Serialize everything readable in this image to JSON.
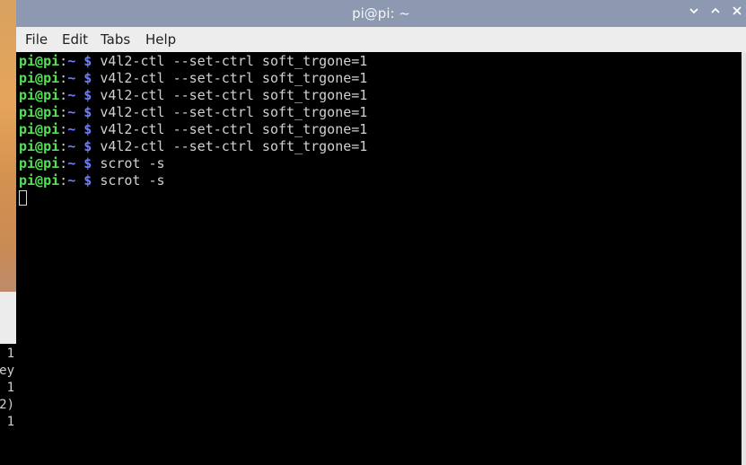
{
  "window": {
    "title": "pi@pi: ~",
    "controls": {
      "minimize": "⌄",
      "maximize": "⌃",
      "close": "✕"
    }
  },
  "menubar": {
    "items": [
      {
        "label": "File"
      },
      {
        "label": "Edit"
      },
      {
        "label": "Tabs"
      },
      {
        "label": "Help"
      }
    ]
  },
  "terminal": {
    "prompt": {
      "user": "pi@pi",
      "colon": ":",
      "path": "~",
      "dollar": "$"
    },
    "lines": [
      {
        "command": "v4l2-ctl --set-ctrl soft_trgone=1"
      },
      {
        "command": "v4l2-ctl --set-ctrl soft_trgone=1"
      },
      {
        "command": "v4l2-ctl --set-ctrl soft_trgone=1"
      },
      {
        "command": "v4l2-ctl --set-ctrl soft_trgone=1"
      },
      {
        "command": "v4l2-ctl --set-ctrl soft_trgone=1"
      },
      {
        "command": "v4l2-ctl --set-ctrl soft_trgone=1"
      },
      {
        "command": "scrot -s"
      },
      {
        "command": "scrot -s"
      }
    ]
  },
  "background_terminal": {
    "lines": [
      "1",
      "ey",
      "1",
      "2)",
      "1"
    ]
  },
  "colors": {
    "titlebar": "#8c99b0",
    "user": "#55e055",
    "path": "#6f7dff",
    "text": "#d0d0d0",
    "terminal_bg": "#000000"
  }
}
